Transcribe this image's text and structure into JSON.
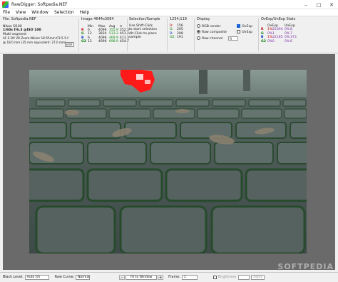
{
  "window": {
    "title": "RawDigger: Softpedia.NEF",
    "controls": [
      "–",
      "□",
      "✕"
    ]
  },
  "menu": [
    "File",
    "View",
    "Window",
    "Selection",
    "Help"
  ],
  "file_info": {
    "title": "File: Softpedia.NEF",
    "camera": "Nikon D100",
    "exposure": "1/60s f/6.3 @ISO 100",
    "mode": "Multi-segment",
    "lens": "AF-S DX VR Zoom-Nikkor 18-55mm f/3.5-5.6G",
    "focal": "@ 18.0 mm (35 mm equivalent: 27.0 mm)",
    "exif_button": "EXIF"
  },
  "image_stats": {
    "title": "Image 4644x3084",
    "headers": [
      "",
      "Min",
      "Max",
      "Avg",
      "σ"
    ],
    "rows": [
      {
        "ch": "R",
        "min": "6",
        "max": "4096",
        "avg": "355.9",
        "sd": "252.6"
      },
      {
        "ch": "G",
        "min": "12",
        "max": "3834",
        "avg": "533.2",
        "sd": "453.2"
      },
      {
        "ch": "B",
        "min": "6",
        "max": "4096",
        "avg": "468.9",
        "sd": "411.0"
      },
      {
        "ch": "G2",
        "min": "12",
        "max": "4096",
        "avg": "698.9",
        "sd": "454.7"
      }
    ]
  },
  "selection": {
    "title": "Selection/Sample",
    "line1": "Use Shift-Click",
    "line2": "to start selection",
    "line3": "Alt-Click to place",
    "line4": "sample"
  },
  "pixel": {
    "coords": "1254;119",
    "rows": [
      {
        "ch": "R:",
        "val": "156"
      },
      {
        "ch": "G:",
        "val": "205"
      },
      {
        "ch": "B:",
        "val": "208"
      },
      {
        "ch": "G2:",
        "val": "191"
      }
    ]
  },
  "display": {
    "title": "Display",
    "rgb_render": "RGB render",
    "raw_composite": "Raw composite",
    "raw_channel": "Raw channel",
    "ovexp": "OvExp",
    "unexp": "UnExp",
    "channel_value": "R"
  },
  "ovexp_stats": {
    "title": "OvExp/UnExp Stats",
    "headers": [
      "",
      "OvExp",
      "UnExp"
    ],
    "rows": [
      {
        "ch": "R",
        "ov_pct": "1%",
        "ov_n": "25394",
        "un_pct": "0%",
        "un_n": "8"
      },
      {
        "ch": "G",
        "ov_pct": "0%",
        "ov_n": "1",
        "un_pct": "0%",
        "un_n": "7"
      },
      {
        "ch": "B",
        "ov_pct": "1%",
        "ov_n": "22185",
        "un_pct": "0%",
        "un_n": "373"
      },
      {
        "ch": "G2",
        "ov_pct": "0%",
        "ov_n": "0",
        "un_pct": "0%",
        "un_n": "6"
      }
    ]
  },
  "statusbar": {
    "black_level_label": "Black Level:",
    "black_level_value": "Auto (0)",
    "raw_curve_label": "Raw Curve:",
    "raw_curve_value": "Normal",
    "zoom_minus": "-",
    "zoom_value": "Fit to Window",
    "zoom_plus": "+",
    "frame_label": "Frame:",
    "frame_value": "1",
    "brightness_label": "Brightness",
    "apply_label": "Apply"
  },
  "watermark": "SOFTPEDIA"
}
